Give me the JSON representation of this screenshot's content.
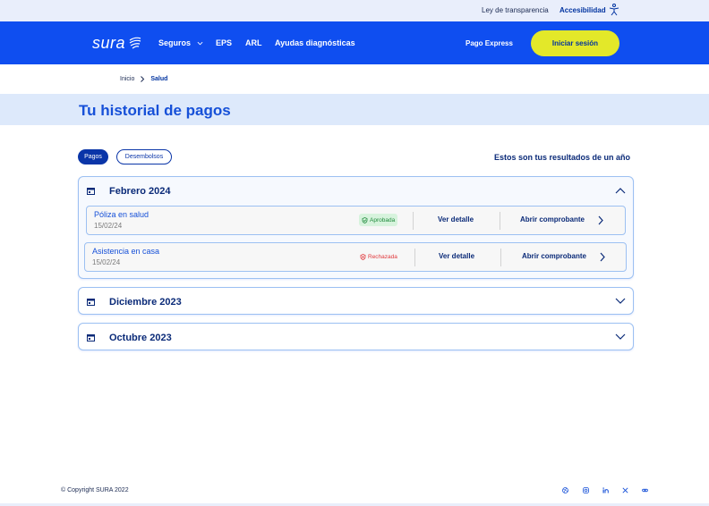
{
  "topbar": {
    "transparency_link": "Ley de transparencia",
    "accessibility_link": "Accesibilidad",
    "accessibility_icon": "accessibility-icon"
  },
  "nav": {
    "logo_text": "sura",
    "items": [
      "Seguros",
      "EPS",
      "ARL",
      "Ayudas diagnósticas"
    ],
    "pago_express": "Pago Express",
    "login_label": "Iniciar sesión",
    "colors": {
      "brand_blue": "#0f4ef0",
      "login_yellow": "#e3e829"
    }
  },
  "breadcrumb": {
    "home": "Inicio",
    "current": "Salud"
  },
  "page": {
    "title": "Tu historial de pagos"
  },
  "filters": {
    "active": "Pagos",
    "inactive": "Desembolsos",
    "results_note": "Estos son tus resultados de un año"
  },
  "months": [
    {
      "title": "Febrero 2024",
      "expanded": true,
      "payments": [
        {
          "name": "Póliza en salud",
          "date": "15/02/24",
          "status": "Aprobada",
          "status_color": "#1f8a3b",
          "detail": "Ver detalle",
          "receipt": "Abrir comprobante"
        },
        {
          "name": "Asistencia en casa",
          "date": "15/02/24",
          "status": "Rechazada",
          "status_color": "#e0373b",
          "detail": "Ver detalle",
          "receipt": "Abrir comprobante"
        }
      ]
    },
    {
      "title": "Diciembre 2023",
      "expanded": false
    },
    {
      "title": "Octubre 2023",
      "expanded": false
    }
  ],
  "footer": {
    "copyright": "© Copyright SURA 2022",
    "social_icons": [
      "dribbble-icon",
      "instagram-icon",
      "linkedin-icon",
      "x-icon",
      "link-icon"
    ]
  }
}
